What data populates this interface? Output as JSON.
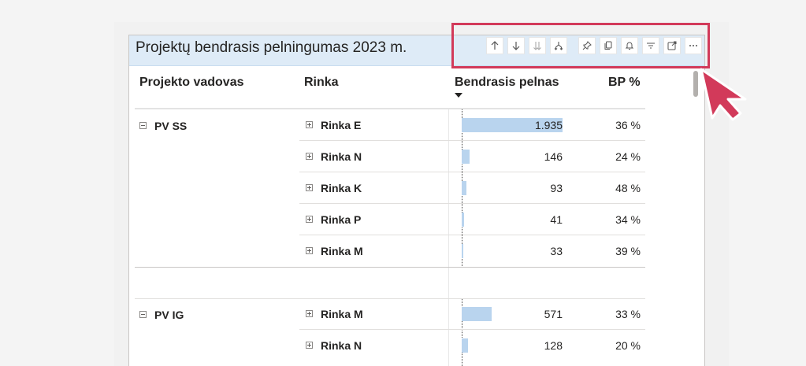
{
  "visual": {
    "title": "Projektų bendrasis pelningumas 2023 m.",
    "header_color": "#deebf7",
    "accent_color": "#d23a5a"
  },
  "toolbar": {
    "buttons": [
      {
        "name": "drill-up",
        "icon": "arrow-up-icon",
        "label": "↑"
      },
      {
        "name": "drill-down",
        "icon": "arrow-down-icon",
        "label": "↓"
      },
      {
        "name": "next-level",
        "icon": "double-arrow-down-icon",
        "label": "⇊"
      },
      {
        "name": "expand-all",
        "icon": "fork-down-icon",
        "label": "⑂"
      },
      {
        "name": "pin-visual",
        "icon": "pin-icon",
        "label": "⚲"
      },
      {
        "name": "copy-visual",
        "icon": "copy-icon",
        "label": "⧉"
      },
      {
        "name": "set-alert",
        "icon": "bell-icon",
        "label": "🔔"
      },
      {
        "name": "filters",
        "icon": "filter-icon",
        "label": "≡"
      },
      {
        "name": "focus-mode",
        "icon": "expand-icon",
        "label": "⤢"
      },
      {
        "name": "more-options",
        "icon": "ellipsis-icon",
        "label": "⋯"
      }
    ]
  },
  "table": {
    "columns": {
      "manager": "Projekto vadovas",
      "market": "Rinka",
      "profit": "Bendrasis pelnas",
      "bp": "BP %"
    },
    "groups": [
      {
        "manager": "PV SS",
        "rows": [
          {
            "market": "Rinka E",
            "profit": "1.935",
            "bp": "36 %",
            "value": 1935
          },
          {
            "market": "Rinka N",
            "profit": "146",
            "bp": "24 %",
            "value": 146
          },
          {
            "market": "Rinka K",
            "profit": "93",
            "bp": "48 %",
            "value": 93
          },
          {
            "market": "Rinka P",
            "profit": "41",
            "bp": "34 %",
            "value": 41
          },
          {
            "market": "Rinka M",
            "profit": "33",
            "bp": "39 %",
            "value": 33
          }
        ]
      },
      {
        "manager": "PV IG",
        "rows": [
          {
            "market": "Rinka M",
            "profit": "571",
            "bp": "33 %",
            "value": 571
          },
          {
            "market": "Rinka N",
            "profit": "128",
            "bp": "20 %",
            "value": 128
          }
        ]
      }
    ]
  }
}
